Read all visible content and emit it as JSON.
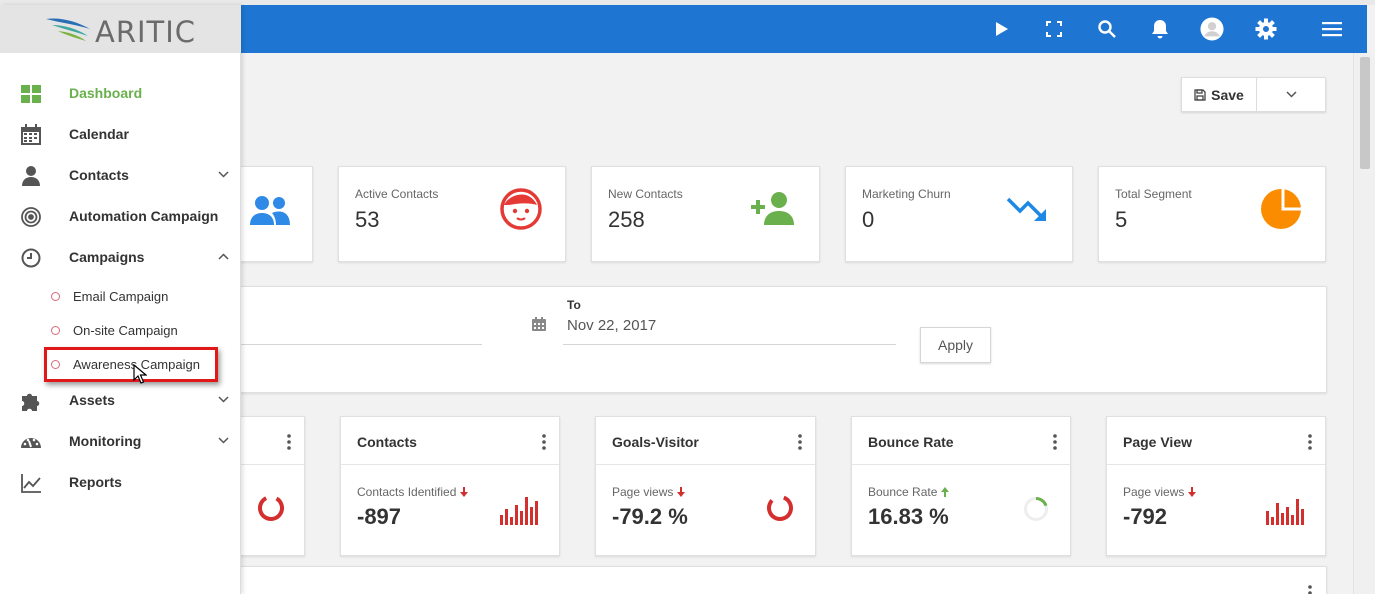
{
  "app": {
    "name": "ARITIC"
  },
  "sidebar": {
    "items": [
      {
        "label": "Dashboard",
        "icon": "dashboard-grid-icon",
        "active": true
      },
      {
        "label": "Calendar",
        "icon": "calendar-icon"
      },
      {
        "label": "Contacts",
        "icon": "person-icon",
        "expandable": true
      },
      {
        "label": "Automation Campaign",
        "icon": "target-icon"
      },
      {
        "label": "Campaigns",
        "icon": "clock-icon",
        "expanded": true
      },
      {
        "label": "Assets",
        "icon": "puzzle-icon",
        "expandable": true
      },
      {
        "label": "Monitoring",
        "icon": "gauge-icon",
        "expandable": true
      },
      {
        "label": "Reports",
        "icon": "line-chart-icon"
      }
    ],
    "campaign_subitems": [
      {
        "label": "Email Campaign"
      },
      {
        "label": "On-site Campaign"
      },
      {
        "label": "Awareness Campaign",
        "highlighted": true
      }
    ]
  },
  "toolbar": {
    "save_label": "Save"
  },
  "stats": [
    {
      "label": "Active Contacts",
      "value": "53",
      "icon": "face-icon",
      "color": "#e53935"
    },
    {
      "label": "New Contacts",
      "value": "258",
      "icon": "add-user-icon",
      "color": "#6ab04c"
    },
    {
      "label": "Marketing Churn",
      "value": "0",
      "icon": "trend-down-icon",
      "color": "#1e88e5"
    },
    {
      "label": "Total Segment",
      "value": "5",
      "icon": "pie-icon",
      "color": "#fb8c00"
    }
  ],
  "filter": {
    "to_label": "To",
    "to_value": "Nov 22, 2017",
    "apply_label": "Apply"
  },
  "metrics": [
    {
      "title": "Contacts",
      "label": "Contacts Identified",
      "value": "-897",
      "trend": "down"
    },
    {
      "title": "Goals-Visitor",
      "label": "Page views",
      "value": "-79.2 %",
      "trend": "down"
    },
    {
      "title": "Bounce Rate",
      "label": "Bounce Rate",
      "value": "16.83 %",
      "trend": "up"
    },
    {
      "title": "Page View",
      "label": "Page views",
      "value": "-792",
      "trend": "down"
    }
  ],
  "colors": {
    "topbar": "#1e76d2",
    "active_nav": "#6ab04c",
    "down": "#d32f2f",
    "up": "#6ab04c"
  }
}
